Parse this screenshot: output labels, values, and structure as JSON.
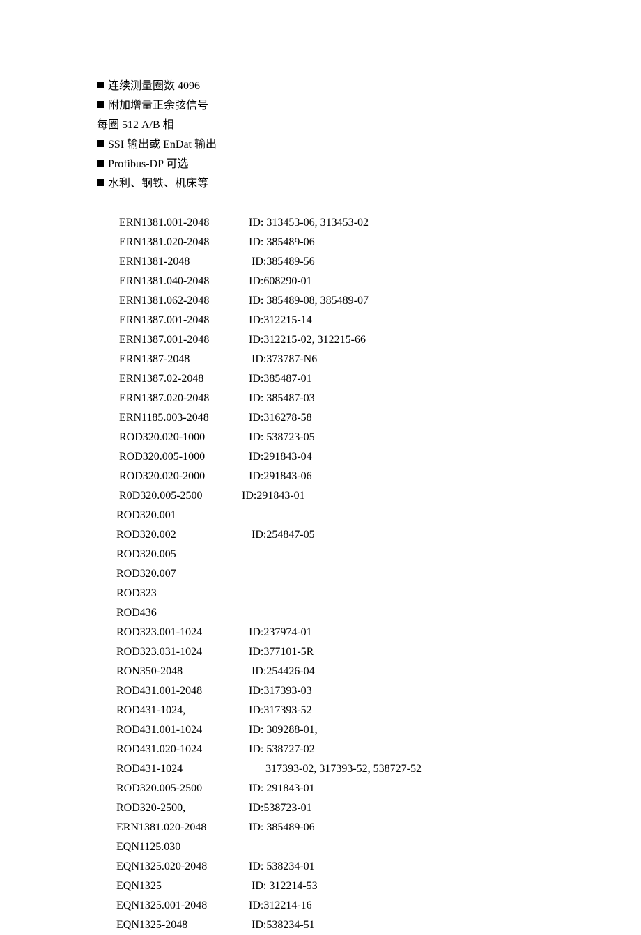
{
  "bullets": [
    "连续测量圈数 4096",
    "附加增量正余弦信号"
  ],
  "subline": "每圈 512 A/B 相",
  "bullets2": [
    "SSI 输出或 EnDat 输出",
    "Profibus-DP 可选",
    "水利、钢铁、机床等"
  ],
  "rows": [
    {
      "model": " ERN1381.001-2048",
      "id": "ID: 313453-06, 313453-02"
    },
    {
      "model": " ERN1381.020-2048",
      "id": "ID: 385489-06"
    },
    {
      "model": " ERN1381-2048",
      "id": " ID:385489-56"
    },
    {
      "model": " ERN1381.040-2048",
      "id": "ID:608290-01"
    },
    {
      "model": " ERN1381.062-2048",
      "id": "ID: 385489-08, 385489-07"
    },
    {
      "model": " ERN1387.001-2048",
      "id": "ID:312215-14"
    },
    {
      "model": " ERN1387.001-2048",
      "id": "ID:312215-02, 312215-66"
    },
    {
      "model": " ERN1387-2048",
      "id": " ID:373787-N6"
    },
    {
      "model": " ERN1387.02-2048",
      "id": "ID:385487-01"
    },
    {
      "model": " ERN1387.020-2048",
      "id": "ID: 385487-03"
    },
    {
      "model": " ERN1185.003-2048",
      "id": "ID:316278-58"
    },
    {
      "model": " ROD320.020-1000",
      "id": "ID: 538723-05"
    },
    {
      "model": " ROD320.005-1000",
      "id": "ID:291843-04"
    },
    {
      "model": " ROD320.020-2000",
      "id": "ID:291843-06"
    },
    {
      "model": " R0D320.005-2500",
      "id": "ID:291843-01",
      "modelWidth": "180px"
    },
    {
      "model": "ROD320.001",
      "id": ""
    },
    {
      "model": "ROD320.002",
      "id": " ID:254847-05"
    },
    {
      "model": "ROD320.005",
      "id": ""
    },
    {
      "model": "ROD320.007",
      "id": ""
    },
    {
      "model": "ROD323",
      "id": ""
    },
    {
      "model": "ROD436",
      "id": ""
    },
    {
      "model": "ROD323.001-1024",
      "id": "ID:237974-01"
    },
    {
      "model": "ROD323.031-1024",
      "id": "ID:377101-5R"
    },
    {
      "model": "RON350-2048",
      "id": " ID:254426-04"
    },
    {
      "model": "ROD431.001-2048",
      "id": "ID:317393-03"
    },
    {
      "model": "ROD431-1024,",
      "id": "ID:317393-52"
    },
    {
      "model": "ROD431.001-1024",
      "id": "ID: 309288-01,"
    },
    {
      "model": "ROD431.020-1024",
      "id": "ID: 538727-02"
    },
    {
      "model": "ROD431-1024",
      "id": "      317393-02, 317393-52, 538727-52"
    },
    {
      "model": "ROD320.005-2500",
      "id": "ID: 291843-01"
    },
    {
      "model": "ROD320-2500,",
      "id": "ID:538723-01"
    },
    {
      "model": "ERN1381.020-2048",
      "id": "ID: 385489-06"
    },
    {
      "model": "EQN1125.030",
      "id": ""
    },
    {
      "model": "EQN1325.020-2048",
      "id": "ID: 538234-01"
    },
    {
      "model": "EQN1325",
      "id": " ID: 312214-53"
    },
    {
      "model": "EQN1325.001-2048",
      "id": "ID:312214-16"
    },
    {
      "model": "EQN1325-2048",
      "id": " ID:538234-51"
    }
  ]
}
